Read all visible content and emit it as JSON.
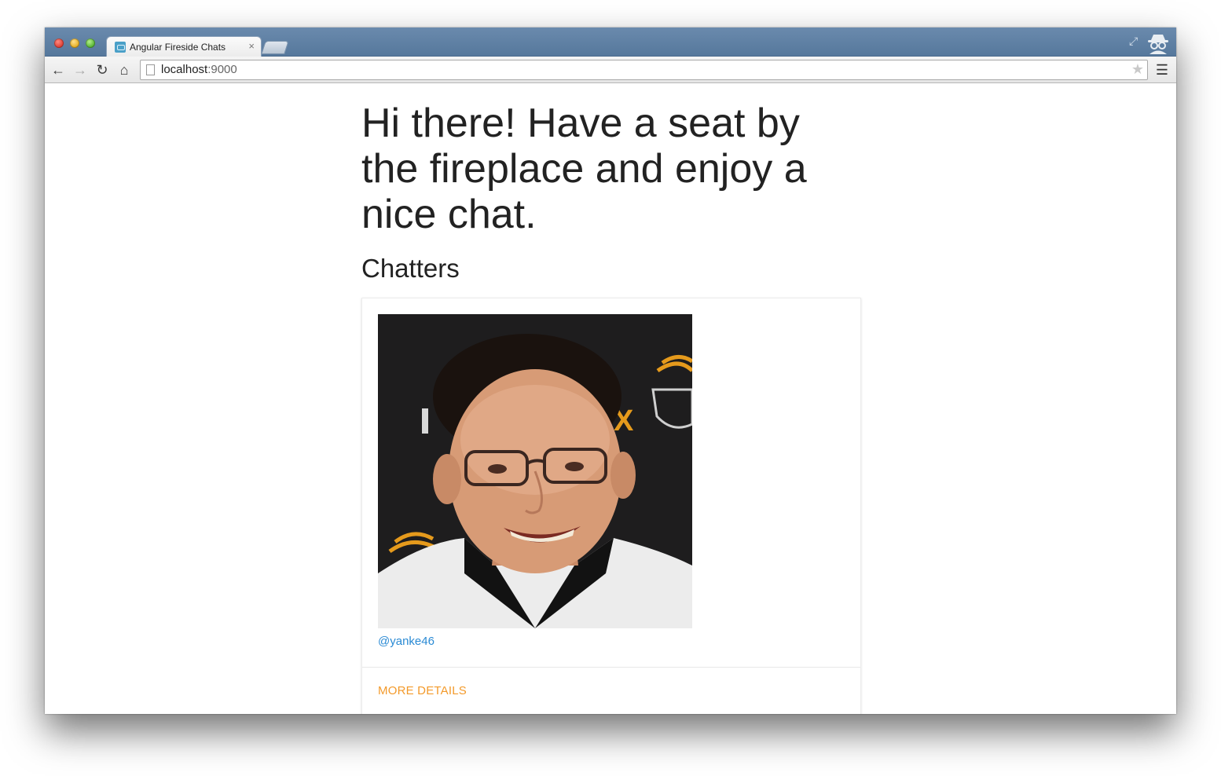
{
  "browser": {
    "tab_title": "Angular Fireside Chats",
    "tab_close": "×",
    "url_host": "localhost",
    "url_port": ":9000",
    "icons": {
      "back": "arrow-left-icon",
      "forward": "arrow-right-icon",
      "reload": "reload-icon",
      "home": "home-icon",
      "bookmark": "star-icon",
      "menu": "hamburger-menu-icon",
      "incognito": "incognito-icon",
      "fullscreen": "fullscreen-icon"
    }
  },
  "page": {
    "headline": "Hi there! Have a seat by the fireplace and enjoy a nice chat.",
    "section_title": "Chatters",
    "chatters": [
      {
        "handle": "@yanke46",
        "action_label": "MORE DETAILS"
      }
    ]
  },
  "colors": {
    "link": "#2a8ad4",
    "accent": "#f39a2b",
    "titlebar": "#5e7fa3"
  }
}
